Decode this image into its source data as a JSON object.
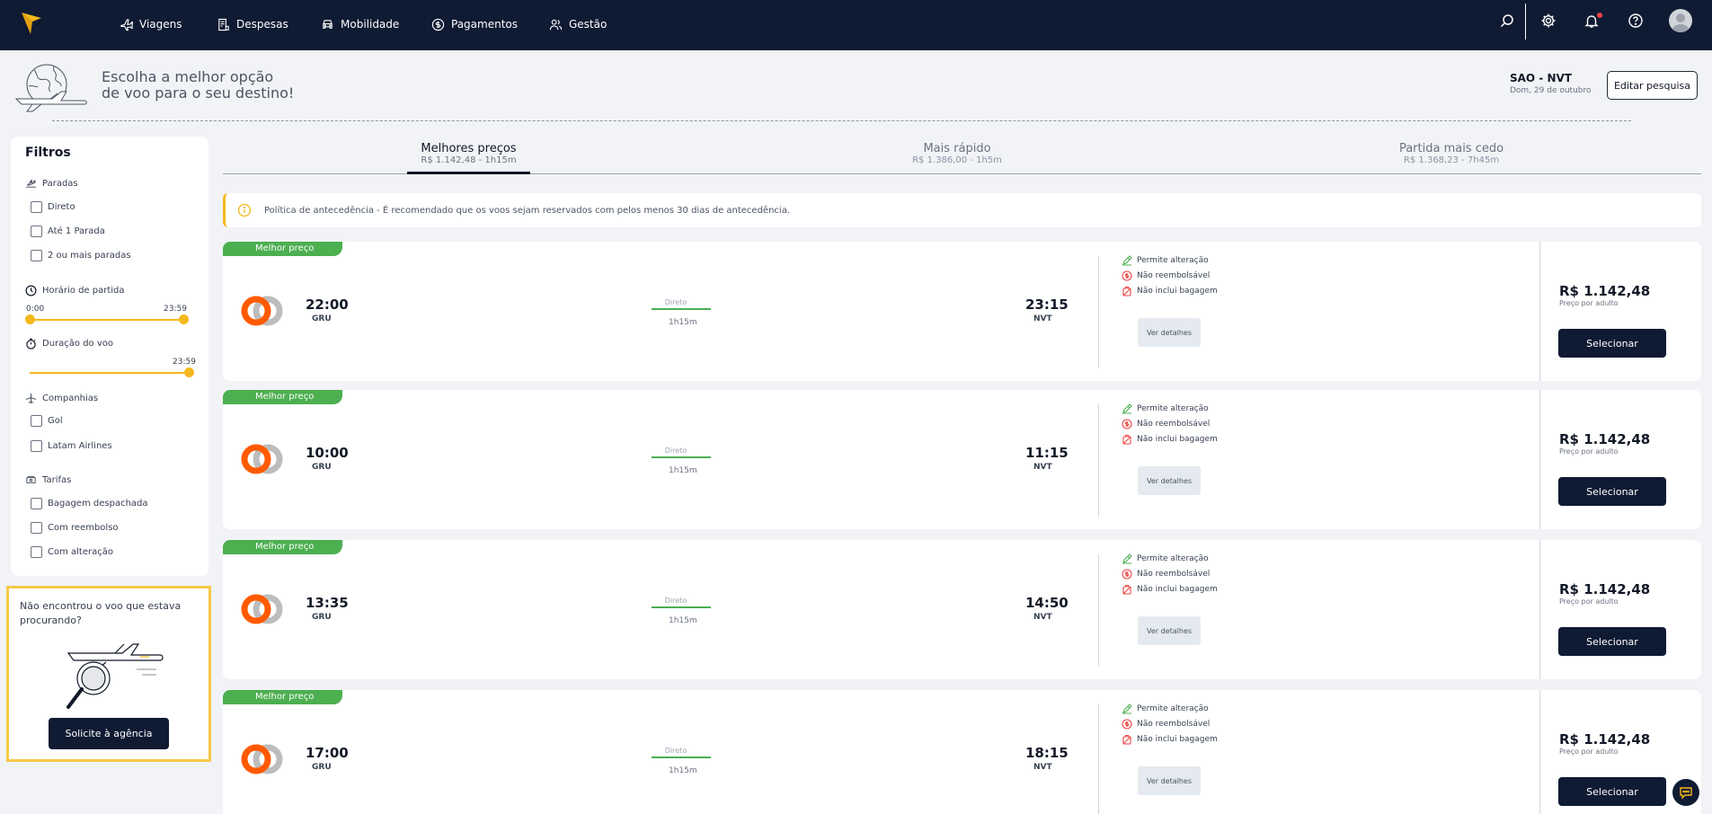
{
  "colors": {
    "nav_bg": "#0f1a33",
    "accent": "#f5b81c",
    "badge": "#4caf50",
    "danger": "#ef4444"
  },
  "nav": {
    "items": [
      {
        "label": "Viagens",
        "icon": "plane-icon"
      },
      {
        "label": "Despesas",
        "icon": "receipt-icon"
      },
      {
        "label": "Mobilidade",
        "icon": "car-icon"
      },
      {
        "label": "Pagamentos",
        "icon": "dollar-icon"
      },
      {
        "label": "Gestão",
        "icon": "users-icon"
      }
    ],
    "right_icons": [
      "search-icon",
      "gear-icon",
      "bell-icon",
      "help-icon",
      "user-avatar-icon"
    ]
  },
  "header": {
    "headline_1": "Escolha a melhor opção",
    "headline_2": "de voo para o seu destino!",
    "route": "SAO - NVT",
    "date": "Dom, 29 de outubro",
    "edit_button": "Editar pesquisa"
  },
  "filters": {
    "title": "Filtros",
    "stops": {
      "title": "Paradas",
      "options": [
        "Direto",
        "Até 1 Parada",
        "2 ou mais paradas"
      ]
    },
    "departure": {
      "title": "Horário de partida",
      "min": "0:00",
      "max": "23:59"
    },
    "duration": {
      "title": "Duração do voo",
      "max": "23:59"
    },
    "airlines": {
      "title": "Companhias",
      "options": [
        "Gol",
        "Latam Airlines"
      ]
    },
    "fares": {
      "title": "Tarifas",
      "options": [
        "Bagagem despachada",
        "Com reembolso",
        "Com alteração"
      ]
    }
  },
  "agency": {
    "text": "Não encontrou o voo que estava procurando?",
    "button": "Solicite à agência"
  },
  "tabs": [
    {
      "title": "Melhores preços",
      "sub": "R$ 1.142,48 - 1h15m",
      "active": true
    },
    {
      "title": "Mais rápido",
      "sub": "R$ 1.386,00 - 1h5m",
      "active": false
    },
    {
      "title": "Partida mais cedo",
      "sub": "R$ 1.368,23 - 7h45m",
      "active": false
    }
  ],
  "policy": "Política de antecedência - É recomendado que os voos sejam reservados com pelos menos 30 dias de antecedência.",
  "flights": [
    {
      "badge": "Melhor preço",
      "dep_time": "22:00",
      "dep_airport": "GRU",
      "stop": "Direto",
      "duration": "1h15m",
      "arr_time": "23:15",
      "arr_airport": "NVT",
      "cond_change": "Permite alteração",
      "cond_refund": "Não reembolsável",
      "cond_bag": "Não inclui bagagem",
      "details": "Ver detalhes",
      "price": "R$ 1.142,48",
      "price_sub": "Preço por adulto",
      "select": "Selecionar"
    },
    {
      "badge": "Melhor preço",
      "dep_time": "10:00",
      "dep_airport": "GRU",
      "stop": "Direto",
      "duration": "1h15m",
      "arr_time": "11:15",
      "arr_airport": "NVT",
      "cond_change": "Permite alteração",
      "cond_refund": "Não reembolsável",
      "cond_bag": "Não inclui bagagem",
      "details": "Ver detalhes",
      "price": "R$ 1.142,48",
      "price_sub": "Preço por adulto",
      "select": "Selecionar"
    },
    {
      "badge": "Melhor preço",
      "dep_time": "13:35",
      "dep_airport": "GRU",
      "stop": "Direto",
      "duration": "1h15m",
      "arr_time": "14:50",
      "arr_airport": "NVT",
      "cond_change": "Permite alteração",
      "cond_refund": "Não reembolsável",
      "cond_bag": "Não inclui bagagem",
      "details": "Ver detalhes",
      "price": "R$ 1.142,48",
      "price_sub": "Preço por adulto",
      "select": "Selecionar"
    },
    {
      "badge": "Melhor preço",
      "dep_time": "17:00",
      "dep_airport": "GRU",
      "stop": "Direto",
      "duration": "1h15m",
      "arr_time": "18:15",
      "arr_airport": "NVT",
      "cond_change": "Permite alteração",
      "cond_refund": "Não reembolsável",
      "cond_bag": "Não inclui bagagem",
      "details": "Ver detalhes",
      "price": "R$ 1.142,48",
      "price_sub": "Preço por adulto",
      "select": "Selecionar"
    }
  ]
}
